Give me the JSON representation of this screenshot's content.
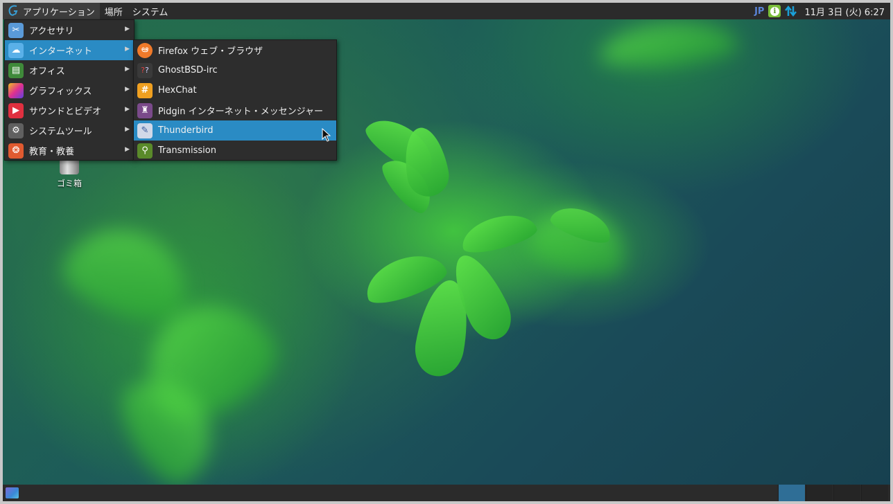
{
  "top_panel": {
    "menus": [
      {
        "label": "アプリケーション"
      },
      {
        "label": "場所"
      },
      {
        "label": "システム"
      }
    ],
    "tray": {
      "keyboard_layout": "JP",
      "clock": "11月 3日 (火)  6:27"
    }
  },
  "desktop": {
    "icons": [
      {
        "label": "ゴミ箱",
        "icon": "trash-icon"
      }
    ]
  },
  "applications_menu": {
    "items": [
      {
        "label": "アクセサリ",
        "icon": "accessories-icon",
        "color": "#5a9ad8"
      },
      {
        "label": "インターネット",
        "icon": "internet-cloud-icon",
        "color": "#4aa0e0",
        "highlighted": true
      },
      {
        "label": "オフィス",
        "icon": "office-icon",
        "color": "#3f8a3a"
      },
      {
        "label": "グラフィックス",
        "icon": "graphics-icon",
        "color": "#c040a0"
      },
      {
        "label": "サウンドとビデオ",
        "icon": "sound-video-icon",
        "color": "#e03040"
      },
      {
        "label": "システムツール",
        "icon": "system-tools-icon",
        "color": "#606060"
      },
      {
        "label": "教育・教養",
        "icon": "education-icon",
        "color": "#e05a30"
      }
    ]
  },
  "internet_submenu": {
    "items": [
      {
        "label": "Firefox ウェブ・ブラウザ",
        "icon": "firefox-icon",
        "color": "#f07a2a"
      },
      {
        "label": "GhostBSD-irc",
        "icon": "irc-chat-icon",
        "color": "#4a4a4a"
      },
      {
        "label": "HexChat",
        "icon": "hexchat-icon",
        "color": "#f0a020"
      },
      {
        "label": "Pidgin インターネット・メッセンジャー",
        "icon": "pidgin-icon",
        "color": "#7a4a8a"
      },
      {
        "label": "Thunderbird",
        "icon": "thunderbird-icon",
        "color": "#d0d8e8",
        "highlighted": true
      },
      {
        "label": "Transmission",
        "icon": "transmission-icon",
        "color": "#5a8a2a"
      }
    ]
  },
  "colors": {
    "panel_bg": "#2b2b2b",
    "menu_bg": "#2d2d2d",
    "highlight": "#2a8bc4",
    "active_workspace": "#2f6e96"
  }
}
